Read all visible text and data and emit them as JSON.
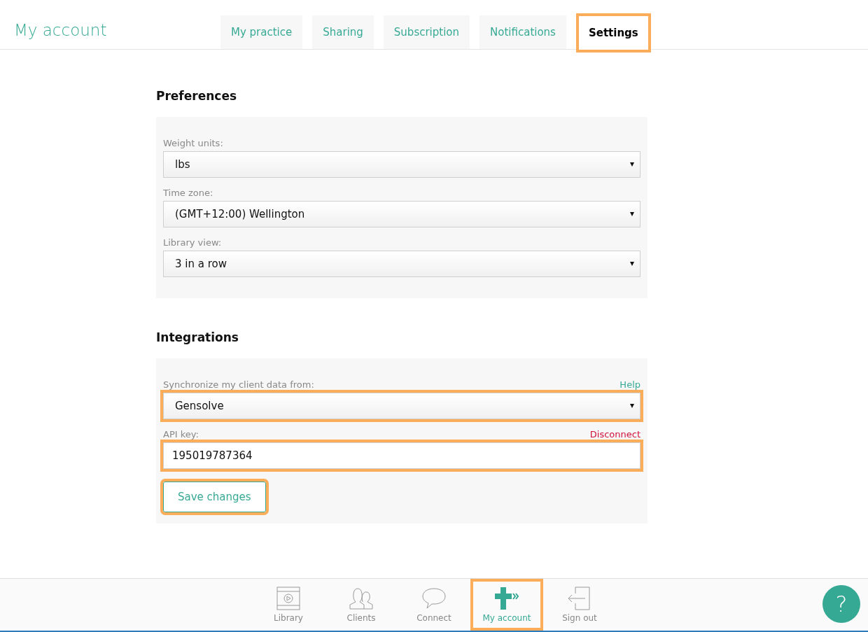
{
  "header": {
    "title": "My account"
  },
  "tabs": [
    {
      "label": "My practice",
      "selected": false,
      "highlighted": false
    },
    {
      "label": "Sharing",
      "selected": false,
      "highlighted": false
    },
    {
      "label": "Subscription",
      "selected": false,
      "highlighted": false
    },
    {
      "label": "Notifications",
      "selected": false,
      "highlighted": false
    },
    {
      "label": "Settings",
      "selected": true,
      "highlighted": true
    }
  ],
  "sections": [
    {
      "heading": "Preferences",
      "fields": [
        {
          "kind": "select",
          "label": "Weight units:",
          "value": "lbs",
          "highlighted": false
        },
        {
          "kind": "select",
          "label": "Time zone:",
          "value": "(GMT+12:00) Wellington",
          "highlighted": false
        },
        {
          "kind": "select",
          "label": "Library view:",
          "value": "3 in a row",
          "highlighted": false
        }
      ]
    },
    {
      "heading": "Integrations",
      "fields": [
        {
          "kind": "select",
          "label": "Synchronize my client data from:",
          "link": {
            "label": "Help",
            "color": "#36a994"
          },
          "value": "Gensolve",
          "highlighted": true
        },
        {
          "kind": "input",
          "label": "API key:",
          "link": {
            "label": "Disconnect",
            "color": "#d0103a"
          },
          "value": "195019787364",
          "highlighted": true
        }
      ],
      "button": {
        "label": "Save changes",
        "highlighted": true
      }
    }
  ],
  "nav": [
    {
      "kind": "library",
      "label": "Library",
      "selected": false,
      "highlighted": false
    },
    {
      "kind": "clients",
      "label": "Clients",
      "selected": false,
      "highlighted": false
    },
    {
      "kind": "connect",
      "label": "Connect",
      "selected": false,
      "highlighted": false
    },
    {
      "kind": "account",
      "label": "My account",
      "selected": true,
      "highlighted": true
    },
    {
      "kind": "signout",
      "label": "Sign out",
      "selected": false,
      "highlighted": false
    }
  ],
  "help_button": {
    "label": "?"
  }
}
